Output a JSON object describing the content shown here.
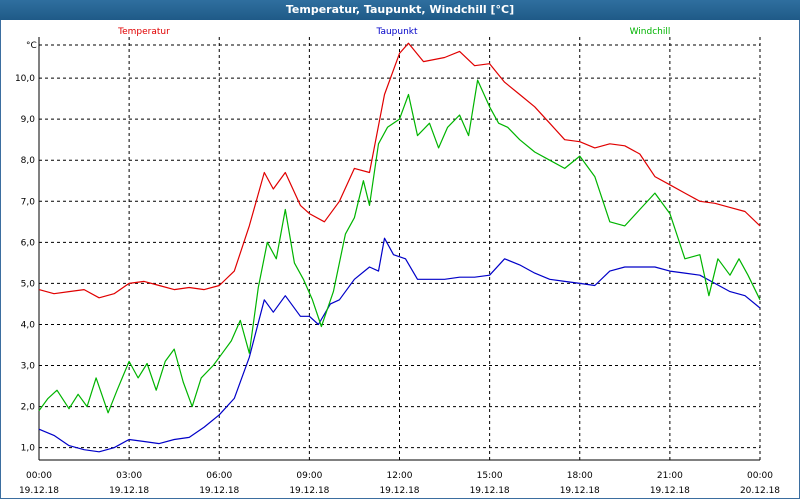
{
  "window": {
    "title": "Temperatur, Taupunkt, Windchill [°C]"
  },
  "chart_data": {
    "type": "line",
    "ylabel": "°C",
    "ylim": [
      0.7,
      11.0
    ],
    "xlim": [
      0,
      24
    ],
    "yticks": [
      1.0,
      2.0,
      3.0,
      4.0,
      5.0,
      6.0,
      7.0,
      8.0,
      9.0,
      10.0
    ],
    "ytick_labels": [
      "1,0",
      "2,0",
      "3,0",
      "4,0",
      "5,0",
      "6,0",
      "7,0",
      "8,0",
      "9,0",
      "10,0"
    ],
    "xticks": [
      {
        "t": 0,
        "time": "00:00",
        "date": "19.12.18"
      },
      {
        "t": 3,
        "time": "03:00",
        "date": "19.12.18"
      },
      {
        "t": 6,
        "time": "06:00",
        "date": "19.12.18"
      },
      {
        "t": 9,
        "time": "09:00",
        "date": "19.12.18"
      },
      {
        "t": 12,
        "time": "12:00",
        "date": "19.12.18"
      },
      {
        "t": 15,
        "time": "15:00",
        "date": "19.12.18"
      },
      {
        "t": 18,
        "time": "18:00",
        "date": "19.12.18"
      },
      {
        "t": 21,
        "time": "21:00",
        "date": "19.12.18"
      },
      {
        "t": 24,
        "time": "00:00",
        "date": "20.12.18"
      }
    ],
    "grid": true,
    "series": [
      {
        "name": "Temperatur",
        "color": "#e00000",
        "points": [
          [
            0,
            4.85
          ],
          [
            0.5,
            4.75
          ],
          [
            1,
            4.8
          ],
          [
            1.5,
            4.85
          ],
          [
            2,
            4.65
          ],
          [
            2.5,
            4.75
          ],
          [
            3,
            5.0
          ],
          [
            3.5,
            5.05
          ],
          [
            4,
            4.95
          ],
          [
            4.5,
            4.85
          ],
          [
            5,
            4.9
          ],
          [
            5.5,
            4.85
          ],
          [
            6,
            4.95
          ],
          [
            6.5,
            5.3
          ],
          [
            7,
            6.4
          ],
          [
            7.5,
            7.7
          ],
          [
            7.8,
            7.3
          ],
          [
            8.2,
            7.7
          ],
          [
            8.7,
            6.9
          ],
          [
            9,
            6.7
          ],
          [
            9.5,
            6.5
          ],
          [
            10,
            7.0
          ],
          [
            10.5,
            7.8
          ],
          [
            11,
            7.7
          ],
          [
            11.5,
            9.6
          ],
          [
            12,
            10.6
          ],
          [
            12.3,
            10.85
          ],
          [
            12.8,
            10.4
          ],
          [
            13.5,
            10.5
          ],
          [
            14,
            10.65
          ],
          [
            14.5,
            10.3
          ],
          [
            15,
            10.35
          ],
          [
            15.5,
            9.9
          ],
          [
            16,
            9.6
          ],
          [
            16.5,
            9.3
          ],
          [
            17,
            8.9
          ],
          [
            17.5,
            8.5
          ],
          [
            18,
            8.45
          ],
          [
            18.5,
            8.3
          ],
          [
            19,
            8.4
          ],
          [
            19.5,
            8.35
          ],
          [
            20,
            8.15
          ],
          [
            20.5,
            7.6
          ],
          [
            21,
            7.4
          ],
          [
            21.5,
            7.2
          ],
          [
            22,
            7.0
          ],
          [
            22.5,
            6.95
          ],
          [
            23,
            6.85
          ],
          [
            23.5,
            6.75
          ],
          [
            24,
            6.4
          ]
        ]
      },
      {
        "name": "Taupunkt",
        "color": "#0000c8",
        "points": [
          [
            0,
            1.45
          ],
          [
            0.5,
            1.3
          ],
          [
            1,
            1.05
          ],
          [
            1.5,
            0.95
          ],
          [
            2,
            0.9
          ],
          [
            2.5,
            1.0
          ],
          [
            3,
            1.2
          ],
          [
            3.5,
            1.15
          ],
          [
            4,
            1.1
          ],
          [
            4.5,
            1.2
          ],
          [
            5,
            1.25
          ],
          [
            5.5,
            1.5
          ],
          [
            6,
            1.8
          ],
          [
            6.5,
            2.2
          ],
          [
            7,
            3.2
          ],
          [
            7.5,
            4.6
          ],
          [
            7.8,
            4.3
          ],
          [
            8.2,
            4.7
          ],
          [
            8.7,
            4.2
          ],
          [
            9,
            4.2
          ],
          [
            9.3,
            4.0
          ],
          [
            9.7,
            4.5
          ],
          [
            10,
            4.6
          ],
          [
            10.5,
            5.1
          ],
          [
            11,
            5.4
          ],
          [
            11.3,
            5.3
          ],
          [
            11.5,
            6.1
          ],
          [
            11.8,
            5.7
          ],
          [
            12.2,
            5.6
          ],
          [
            12.6,
            5.1
          ],
          [
            13,
            5.1
          ],
          [
            13.5,
            5.1
          ],
          [
            14,
            5.15
          ],
          [
            14.5,
            5.15
          ],
          [
            15,
            5.2
          ],
          [
            15.5,
            5.6
          ],
          [
            16,
            5.45
          ],
          [
            16.5,
            5.25
          ],
          [
            17,
            5.1
          ],
          [
            17.5,
            5.05
          ],
          [
            18,
            5.0
          ],
          [
            18.5,
            4.95
          ],
          [
            19,
            5.3
          ],
          [
            19.5,
            5.4
          ],
          [
            20,
            5.4
          ],
          [
            20.5,
            5.4
          ],
          [
            21,
            5.3
          ],
          [
            21.5,
            5.25
          ],
          [
            22,
            5.2
          ],
          [
            22.5,
            5.0
          ],
          [
            23,
            4.8
          ],
          [
            23.5,
            4.7
          ],
          [
            24,
            4.4
          ]
        ]
      },
      {
        "name": "Windchill",
        "color": "#00b400",
        "points": [
          [
            0,
            1.9
          ],
          [
            0.3,
            2.2
          ],
          [
            0.6,
            2.4
          ],
          [
            1,
            1.95
          ],
          [
            1.3,
            2.3
          ],
          [
            1.6,
            2.0
          ],
          [
            1.9,
            2.7
          ],
          [
            2.3,
            1.85
          ],
          [
            2.6,
            2.4
          ],
          [
            3,
            3.1
          ],
          [
            3.3,
            2.7
          ],
          [
            3.6,
            3.05
          ],
          [
            3.9,
            2.4
          ],
          [
            4.2,
            3.1
          ],
          [
            4.5,
            3.4
          ],
          [
            4.8,
            2.6
          ],
          [
            5.1,
            2.0
          ],
          [
            5.4,
            2.7
          ],
          [
            5.8,
            3.0
          ],
          [
            6.1,
            3.3
          ],
          [
            6.4,
            3.6
          ],
          [
            6.7,
            4.1
          ],
          [
            7,
            3.3
          ],
          [
            7.3,
            4.9
          ],
          [
            7.6,
            6.0
          ],
          [
            7.9,
            5.6
          ],
          [
            8.2,
            6.8
          ],
          [
            8.5,
            5.5
          ],
          [
            8.8,
            5.1
          ],
          [
            9.1,
            4.6
          ],
          [
            9.4,
            3.95
          ],
          [
            9.8,
            4.8
          ],
          [
            10.2,
            6.2
          ],
          [
            10.5,
            6.6
          ],
          [
            10.8,
            7.5
          ],
          [
            11,
            6.9
          ],
          [
            11.3,
            8.4
          ],
          [
            11.6,
            8.8
          ],
          [
            12,
            9.0
          ],
          [
            12.3,
            9.6
          ],
          [
            12.6,
            8.6
          ],
          [
            13,
            8.9
          ],
          [
            13.3,
            8.3
          ],
          [
            13.6,
            8.8
          ],
          [
            14,
            9.1
          ],
          [
            14.3,
            8.6
          ],
          [
            14.6,
            9.95
          ],
          [
            15,
            9.3
          ],
          [
            15.3,
            8.9
          ],
          [
            15.6,
            8.8
          ],
          [
            16,
            8.5
          ],
          [
            16.5,
            8.2
          ],
          [
            17,
            8.0
          ],
          [
            17.5,
            7.8
          ],
          [
            18,
            8.1
          ],
          [
            18.5,
            7.6
          ],
          [
            19,
            6.5
          ],
          [
            19.5,
            6.4
          ],
          [
            20,
            6.8
          ],
          [
            20.5,
            7.2
          ],
          [
            21,
            6.7
          ],
          [
            21.5,
            5.6
          ],
          [
            22,
            5.7
          ],
          [
            22.3,
            4.7
          ],
          [
            22.6,
            5.6
          ],
          [
            23,
            5.2
          ],
          [
            23.3,
            5.6
          ],
          [
            23.6,
            5.2
          ],
          [
            24,
            4.6
          ]
        ]
      }
    ],
    "legend": "top"
  }
}
